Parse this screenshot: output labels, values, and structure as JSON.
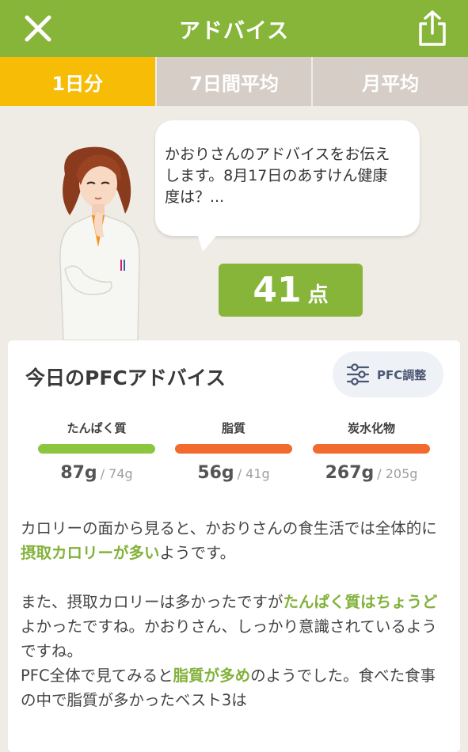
{
  "header": {
    "title": "アドバイス",
    "close_icon": "close-icon",
    "share_icon": "share-icon"
  },
  "tabs": [
    {
      "label": "1日分",
      "active": true
    },
    {
      "label": "7日間平均",
      "active": false
    },
    {
      "label": "月平均",
      "active": false
    }
  ],
  "bubble": {
    "line1": "かおりさんのアドバイスをお伝え",
    "line2": "します。8月17日のあすけん健康",
    "line3": "度は？..."
  },
  "score": {
    "value": "41",
    "unit": "点"
  },
  "card": {
    "title": "今日のPFCアドバイス",
    "pfc_button": "PFC調整"
  },
  "metrics": [
    {
      "label": "たんぱく質",
      "value": "87g",
      "target": "/ 74g",
      "color": "#8cc63f"
    },
    {
      "label": "脂質",
      "value": "56g",
      "target": "/ 41g",
      "color": "#f26a2e"
    },
    {
      "label": "炭水化物",
      "value": "267g",
      "target": "/ 205g",
      "color": "#f26a2e"
    }
  ],
  "advice": {
    "p1_a": "カロリーの面から見ると、かおりさんの食生活では全体的に",
    "p1_hl": "摂取カロリーが多い",
    "p1_b": "ようです。",
    "p2_a": "また、摂取カロリーは多かったですが",
    "p2_hl": "たんぱく質はちょうど",
    "p2_b": "よかったですね。かおりさん、しっかり意識されているようですね。",
    "p3_a": "PFC全体で見てみると",
    "p3_hl": "脂質が多め",
    "p3_b": "のようでした。食べた食事の中で脂質が多かったベスト3は"
  },
  "colors": {
    "brand_green": "#86b53a",
    "active_tab": "#f7bc05",
    "inactive_tab": "#d5cdc6",
    "highlight": "#82b23a"
  }
}
